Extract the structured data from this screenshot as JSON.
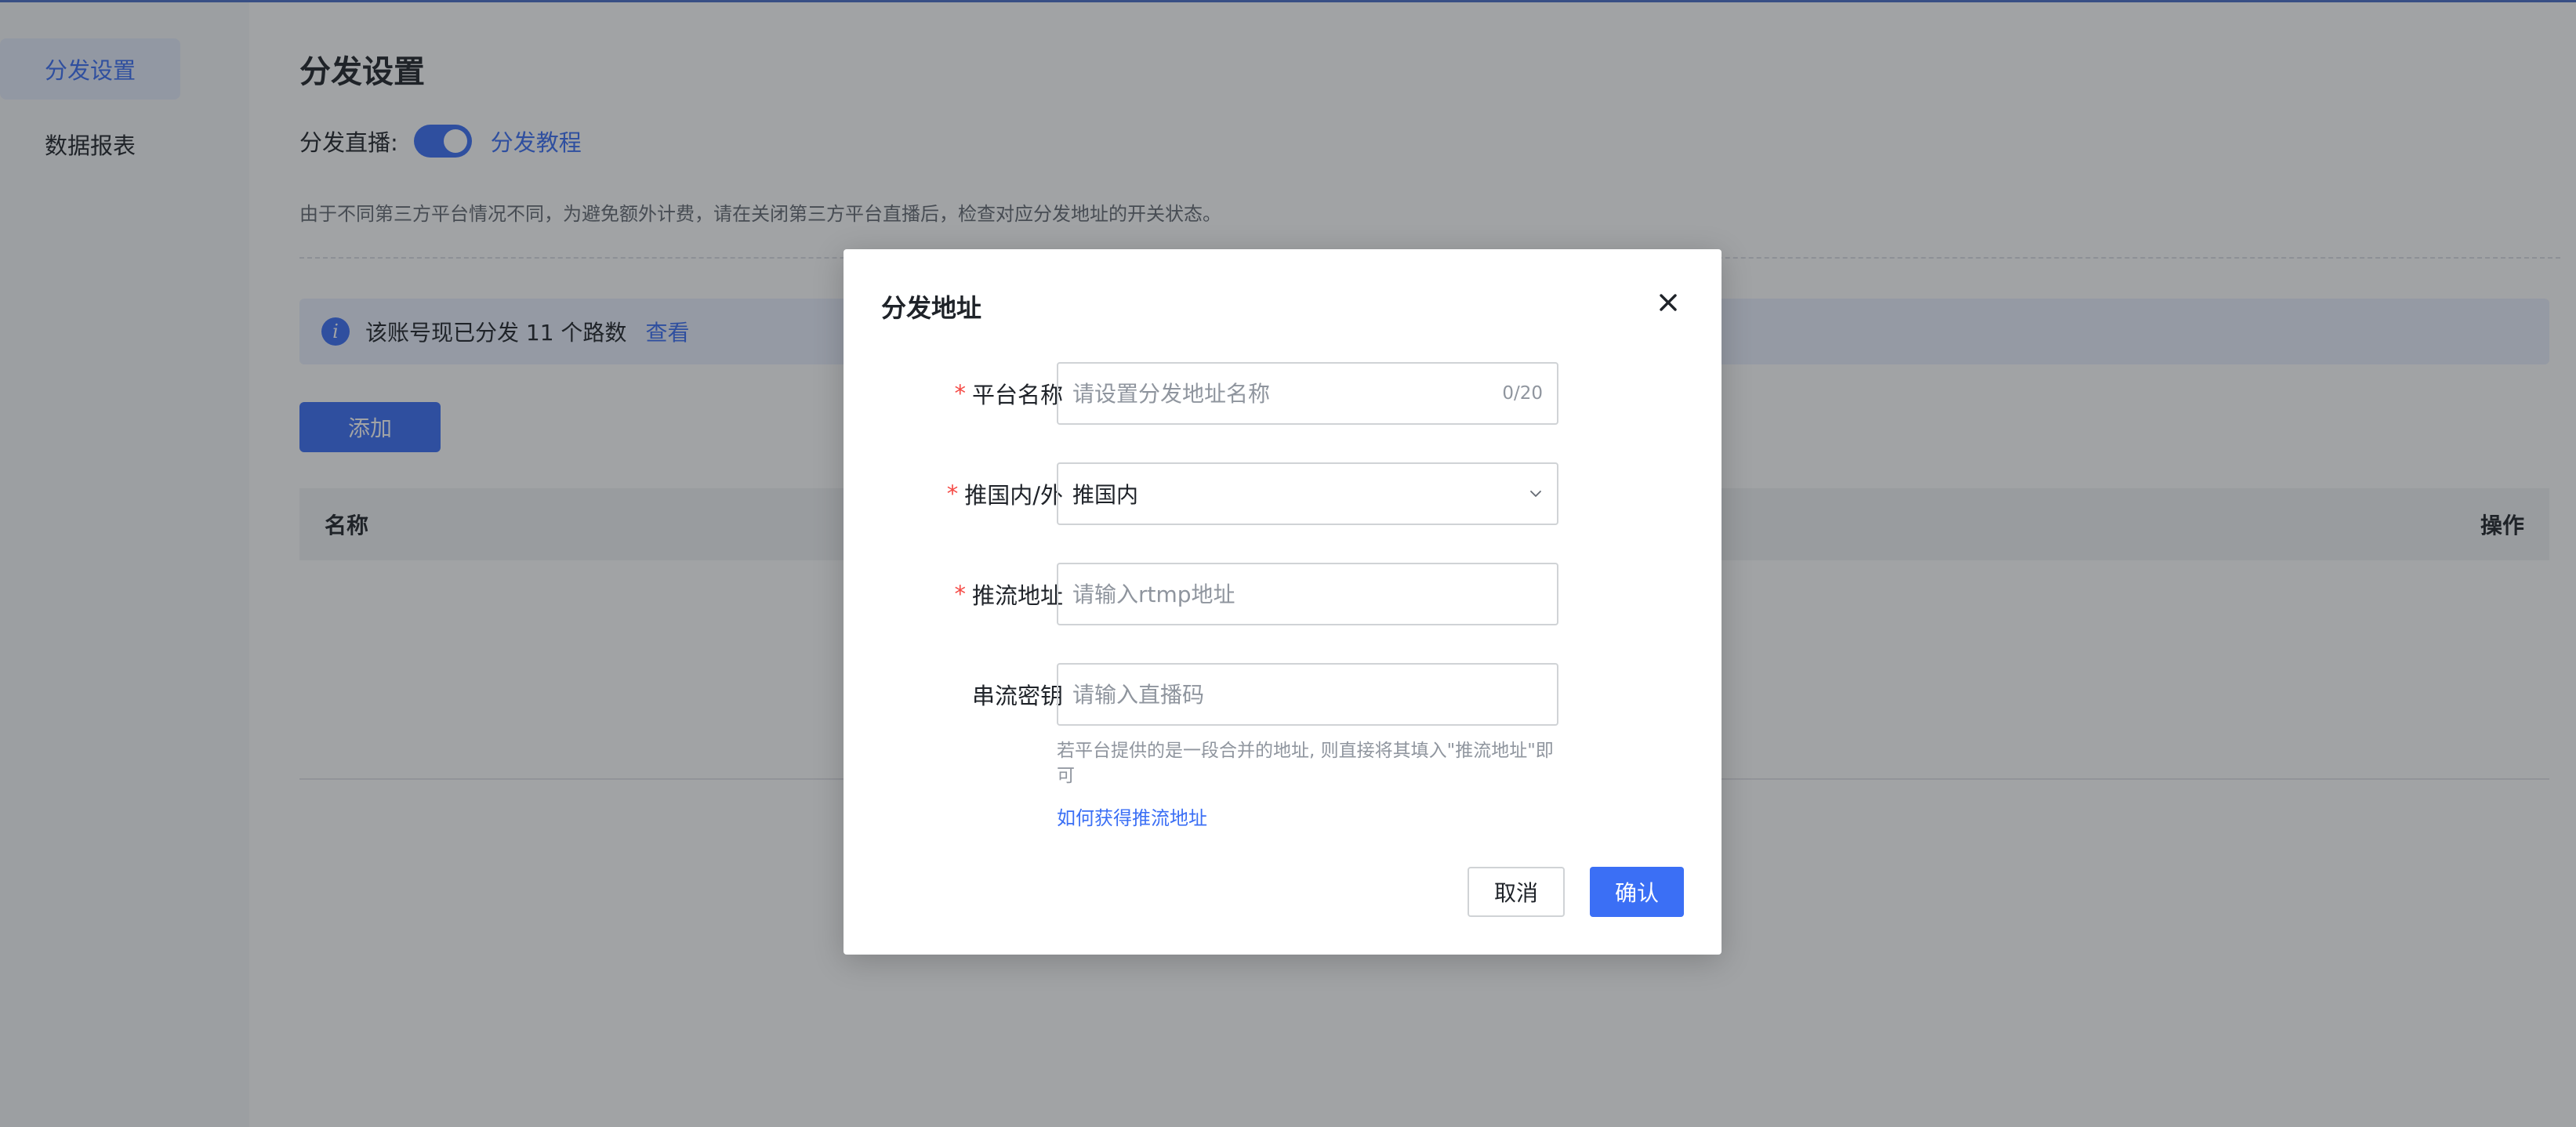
{
  "sidebar": {
    "items": [
      {
        "label": "分发设置"
      },
      {
        "label": "数据报表"
      }
    ]
  },
  "main": {
    "title": "分发设置",
    "live_toggle": {
      "label": "分发直播:",
      "on": true,
      "tutorial_link": "分发教程"
    },
    "description": "由于不同第三方平台情况不同，为避免额外计费，请在关闭第三方平台直播后，检查对应分发地址的开关状态。",
    "info": {
      "text": "该账号现已分发 11 个路数",
      "link": "查看"
    },
    "add_button": "添加",
    "table": {
      "columns": [
        "名称",
        "操作"
      ]
    }
  },
  "modal": {
    "title": "分发地址",
    "close_icon": "close-icon",
    "fields": {
      "platform_name": {
        "label": "平台名称",
        "required": true,
        "placeholder": "请设置分发地址名称",
        "value": "",
        "counter": "0/20"
      },
      "region": {
        "label": "推国内/外",
        "required": true,
        "value": "推国内"
      },
      "push_url": {
        "label": "推流地址",
        "required": true,
        "placeholder": "请输入rtmp地址",
        "value": ""
      },
      "stream_key": {
        "label": "串流密钥",
        "required": false,
        "placeholder": "请输入直播码",
        "value": ""
      }
    },
    "help_text": "若平台提供的是一段合并的地址, 则直接将其填入\"推流地址\"即可",
    "help_link": "如何获得推流地址",
    "cancel_label": "取消",
    "confirm_label": "确认"
  },
  "colors": {
    "accent": "#3b6ff5",
    "required_mark": "#f54a45",
    "overlay": "rgba(31,35,41,0.42)"
  }
}
